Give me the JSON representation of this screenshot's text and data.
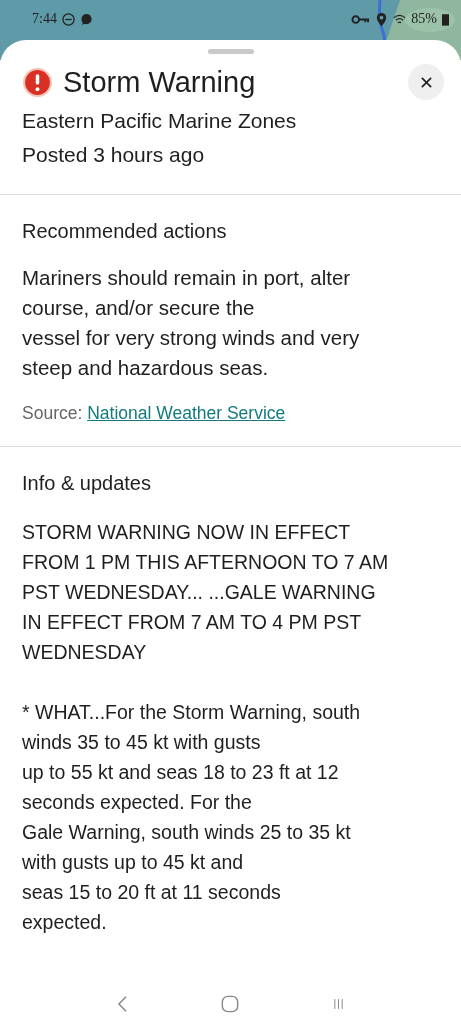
{
  "status_bar": {
    "time": "7:44",
    "battery": "85%"
  },
  "alert": {
    "title": "Storm Warning",
    "area": "Eastern Pacific Marine Zones",
    "posted": "Posted 3 hours ago"
  },
  "recommended": {
    "heading": "Recommended actions",
    "text": "Mariners should remain in port, alter\ncourse, and/or secure the\nvessel for very strong winds and very\nsteep and hazardous seas.",
    "source_label": "Source:",
    "source_link": "National Weather Service"
  },
  "info": {
    "heading": "Info & updates",
    "paragraphs": [
      "STORM WARNING NOW IN EFFECT\nFROM 1 PM THIS AFTERNOON TO 7 AM\nPST WEDNESDAY... ...GALE WARNING\nIN EFFECT FROM 7 AM TO 4 PM PST\nWEDNESDAY",
      "* WHAT...For the Storm Warning, south\nwinds 35 to 45 kt with gusts\nup to 55 kt and seas 18 to 23 ft at 12\nseconds expected. For the\nGale Warning, south winds 25 to 35 kt\nwith gusts up to 45 kt and\nseas 15 to 20 ft at 11 seconds\nexpected."
    ]
  }
}
